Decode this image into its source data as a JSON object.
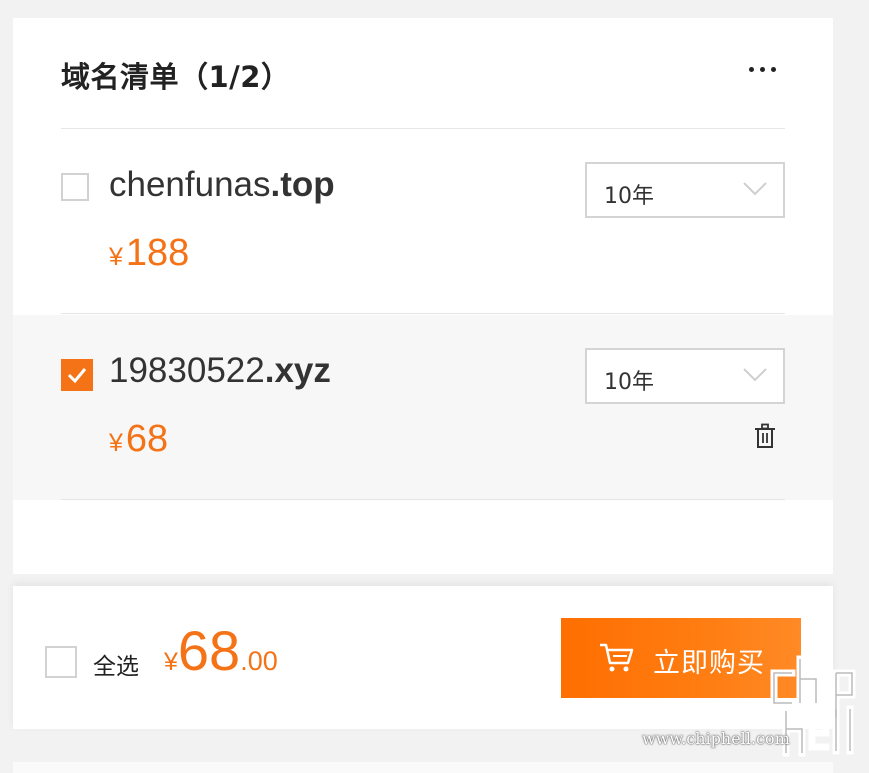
{
  "header": {
    "title": "域名清单（1/2）",
    "more_icon": "more-horizontal-icon"
  },
  "items": [
    {
      "name": "chenfunas",
      "tld": ".top",
      "price_symbol": "¥",
      "price": "188",
      "period": "10年",
      "checked": false
    },
    {
      "name": "19830522",
      "tld": ".xyz",
      "price_symbol": "¥",
      "price": "68",
      "period": "10年",
      "checked": true,
      "action_icon": "trash-icon"
    }
  ],
  "footer": {
    "select_all_label": "全选",
    "total_symbol": "¥",
    "total_integer": "68",
    "total_decimal": ".00",
    "buy_label": "立即购买",
    "buy_icon": "cart-icon"
  },
  "watermark": {
    "site": "www.chiphell.com"
  },
  "colors": {
    "accent": "#f47317",
    "button": "#ff7a0e",
    "border": "#d4d4d4",
    "selected_row_bg": "#f7f7f7"
  }
}
